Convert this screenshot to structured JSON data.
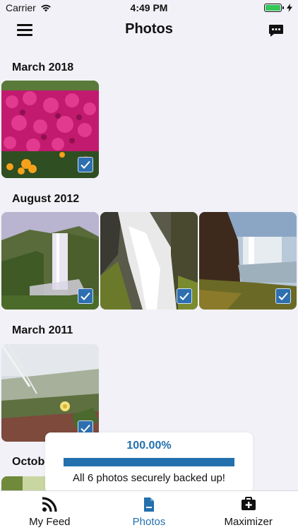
{
  "status_bar": {
    "carrier": "Carrier",
    "time": "4:49 PM"
  },
  "header": {
    "title": "Photos",
    "menu_icon": "hamburger-menu-icon",
    "chat_icon": "chat-bubble-icon"
  },
  "sections": [
    {
      "title": "March 2018",
      "photos": [
        "flowers-pink",
        ""
      ]
    },
    {
      "title": "August 2012",
      "photos": [
        "waterfall-1",
        "waterfall-2",
        "waterfall-3"
      ]
    },
    {
      "title": "March 2011",
      "photos": [
        "meadow-flower"
      ]
    },
    {
      "title": "October"
    }
  ],
  "toast": {
    "percent": "100.00%",
    "progress": 1.0,
    "message": "All 6 photos securely backed up!"
  },
  "tabs": [
    {
      "label": "My Feed",
      "icon": "rss-feed-icon"
    },
    {
      "label": "Photos",
      "icon": "document-icon",
      "active": true
    },
    {
      "label": "Maximizer",
      "icon": "medkit-plus-icon"
    }
  ],
  "colors": {
    "accent": "#2370ae",
    "check": "#2e6fb0",
    "battery": "#34c759",
    "background": "#f2f1f7"
  }
}
